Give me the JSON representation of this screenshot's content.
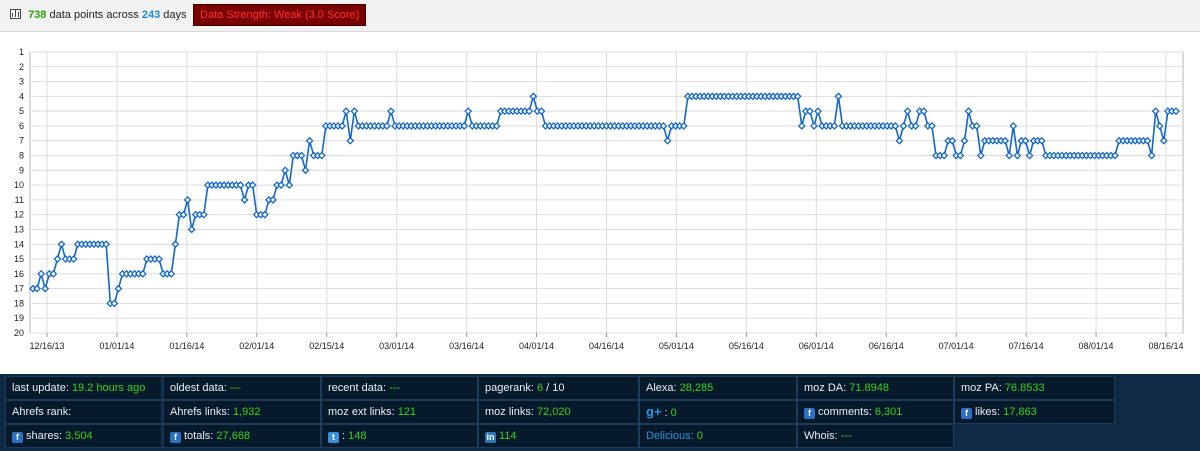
{
  "summary": {
    "points": "738",
    "points_text": "data points across",
    "days": "243",
    "days_text": "days",
    "strength_label": "Data Strength: Weak (3.0 Score)"
  },
  "chart_data": {
    "type": "line",
    "title": "",
    "xlabel": "",
    "ylabel": "",
    "ylim": [
      1,
      20
    ],
    "y_inverted": true,
    "grid": true,
    "legend": "none",
    "line_color": "#1467c8",
    "marker": "diamond",
    "y_ticks": [
      1,
      2,
      3,
      4,
      5,
      6,
      7,
      8,
      9,
      10,
      11,
      12,
      13,
      14,
      15,
      16,
      17,
      18,
      19,
      20
    ],
    "x_tick_labels": [
      "12/16/13",
      "01/01/14",
      "01/16/14",
      "02/01/14",
      "02/15/14",
      "03/01/14",
      "03/16/14",
      "04/01/14",
      "04/16/14",
      "05/01/14",
      "05/16/14",
      "06/01/14",
      "06/16/14",
      "07/01/14",
      "07/16/14",
      "08/01/14",
      "08/16/14"
    ],
    "series": [
      {
        "values": [
          17,
          17,
          16,
          17,
          16,
          16,
          15,
          14,
          15,
          15,
          15,
          14,
          14,
          14,
          14,
          14,
          14,
          14,
          14,
          18,
          18,
          17,
          16,
          16,
          16,
          16,
          16,
          16,
          15,
          15,
          15,
          15,
          16,
          16,
          16,
          14,
          12,
          12,
          11,
          13,
          12,
          12,
          12,
          10,
          10,
          10,
          10,
          10,
          10,
          10,
          10,
          10,
          11,
          10,
          10,
          12,
          12,
          12,
          11,
          11,
          10,
          10,
          9,
          10,
          8,
          8,
          8,
          9,
          7,
          8,
          8,
          8,
          6,
          6,
          6,
          6,
          6,
          5,
          7,
          5,
          6,
          6,
          6,
          6,
          6,
          6,
          6,
          6,
          5,
          6,
          6,
          6,
          6,
          6,
          6,
          6,
          6,
          6,
          6,
          6,
          6,
          6,
          6,
          6,
          6,
          6,
          6,
          5,
          6,
          6,
          6,
          6,
          6,
          6,
          6,
          5,
          5,
          5,
          5,
          5,
          5,
          5,
          5,
          4,
          5,
          5,
          6,
          6,
          6,
          6,
          6,
          6,
          6,
          6,
          6,
          6,
          6,
          6,
          6,
          6,
          6,
          6,
          6,
          6,
          6,
          6,
          6,
          6,
          6,
          6,
          6,
          6,
          6,
          6,
          6,
          6,
          7,
          6,
          6,
          6,
          6,
          4,
          4,
          4,
          4,
          4,
          4,
          4,
          4,
          4,
          4,
          4,
          4,
          4,
          4,
          4,
          4,
          4,
          4,
          4,
          4,
          4,
          4,
          4,
          4,
          4,
          4,
          4,
          4,
          6,
          5,
          5,
          6,
          5,
          6,
          6,
          6,
          6,
          4,
          6,
          6,
          6,
          6,
          6,
          6,
          6,
          6,
          6,
          6,
          6,
          6,
          6,
          6,
          7,
          6,
          5,
          6,
          6,
          5,
          5,
          6,
          6,
          8,
          8,
          8,
          7,
          7,
          8,
          8,
          7,
          5,
          6,
          6,
          8,
          7,
          7,
          7,
          7,
          7,
          7,
          8,
          6,
          8,
          7,
          7,
          8,
          7,
          7,
          7,
          8,
          8,
          8,
          8,
          8,
          8,
          8,
          8,
          8,
          8,
          8,
          8,
          8,
          8,
          8,
          8,
          8,
          8,
          7,
          7,
          7,
          7,
          7,
          7,
          7,
          7,
          8,
          5,
          6,
          7,
          5,
          5,
          5
        ]
      }
    ]
  },
  "stats": [
    {
      "label": "last update:",
      "value": "19.2 hours ago",
      "icon": ""
    },
    {
      "label": "oldest data:",
      "value": "---",
      "icon": ""
    },
    {
      "label": "recent data:",
      "value": "---",
      "icon": ""
    },
    {
      "label": "pagerank:",
      "value": "6",
      "suffix": " / 10",
      "icon": ""
    },
    {
      "label": "Alexa:",
      "value": "28,285",
      "icon": ""
    },
    {
      "label": "moz DA:",
      "value": "71.8948",
      "icon": ""
    },
    {
      "label": "moz PA:",
      "value": "76.8533",
      "icon": ""
    },
    {
      "label": "Ahrefs rank:",
      "value": "",
      "icon": ""
    },
    {
      "label": "Ahrefs links:",
      "value": "1,932",
      "icon": ""
    },
    {
      "label": "moz ext links:",
      "value": "121",
      "icon": ""
    },
    {
      "label": "moz links:",
      "value": "72,020",
      "icon": ""
    },
    {
      "label": ":",
      "value": "0",
      "icon": "google-plus-icon"
    },
    {
      "label": "comments:",
      "value": "6,301",
      "icon": "facebook-icon"
    },
    {
      "label": "likes:",
      "value": "17,863",
      "icon": "facebook-icon"
    },
    {
      "label": "shares:",
      "value": "3,504",
      "icon": "facebook-icon"
    },
    {
      "label": "totals:",
      "value": "27,668",
      "icon": "facebook-icon"
    },
    {
      "label": ":",
      "value": "148",
      "icon": "twitter-icon"
    },
    {
      "label": "",
      "value": "114",
      "icon": "linkedin-icon"
    },
    {
      "label": "Delicious:",
      "value": "0",
      "icon": ""
    },
    {
      "label": "Whois:",
      "value": "---",
      "icon": ""
    }
  ],
  "colors": {
    "value_green": "#33d11e",
    "value_blue": "#2a93e0",
    "panel_dark": "#071a2c",
    "strength_bg": "#7a0000",
    "strength_text": "#ff3030"
  }
}
